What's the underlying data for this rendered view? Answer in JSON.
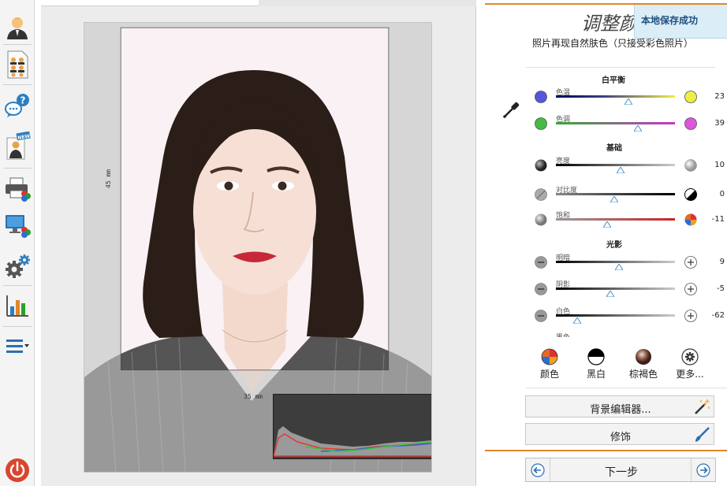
{
  "toolbar": {
    "items": [
      {
        "name": "user-icon"
      },
      {
        "name": "id-photo-sheet-icon"
      },
      {
        "name": "help-chat-icon"
      },
      {
        "name": "new-photo-icon"
      },
      {
        "name": "print-icon"
      },
      {
        "name": "color-monitor-icon"
      },
      {
        "name": "settings-gears-icon"
      },
      {
        "name": "statistics-chart-icon"
      },
      {
        "name": "menu-list-icon"
      },
      {
        "name": "power-icon"
      }
    ]
  },
  "canvas": {
    "width_dim": "35 mm",
    "height_dim": "45 mm"
  },
  "panel": {
    "title": "调整颜色",
    "save_notice": "本地保存成功",
    "subtitle": "照片再现自然肤色（只接受彩色照片）",
    "sections": {
      "white_balance": "白平衡",
      "basic": "基础",
      "light_shadow": "光影"
    },
    "sliders": {
      "temperature": {
        "label": "色温",
        "value": "23",
        "position": 0.61
      },
      "tint": {
        "label": "色调",
        "value": "39",
        "position": 0.69
      },
      "brightness": {
        "label": "亮度",
        "value": "10",
        "position": 0.54
      },
      "contrast": {
        "label": "对比度",
        "value": "0",
        "position": 0.49
      },
      "saturation": {
        "label": "饱和",
        "value": "-11",
        "position": 0.43
      },
      "highlights": {
        "label": "明暗",
        "value": "9",
        "position": 0.53
      },
      "shadows": {
        "label": "阴影",
        "value": "-5",
        "position": 0.46
      },
      "whites": {
        "label": "白色",
        "value": "-62",
        "position": 0.18
      },
      "blacks": {
        "label": "黑色"
      }
    },
    "presets": {
      "color": "颜色",
      "bw": "黑白",
      "sepia": "棕褐色",
      "more": "更多..."
    },
    "background_editor": "背景编辑器...",
    "retouch": "修饰",
    "next_step": "下一步"
  },
  "colors": {
    "accent_orange": "#e2862a",
    "notice_bg": "#dbeef8",
    "temp_cold": "#5555dd",
    "temp_warm": "#eeee44",
    "tint_green": "#44bb44",
    "tint_magenta": "#dd55dd",
    "saturation_red": "#cc2222"
  }
}
